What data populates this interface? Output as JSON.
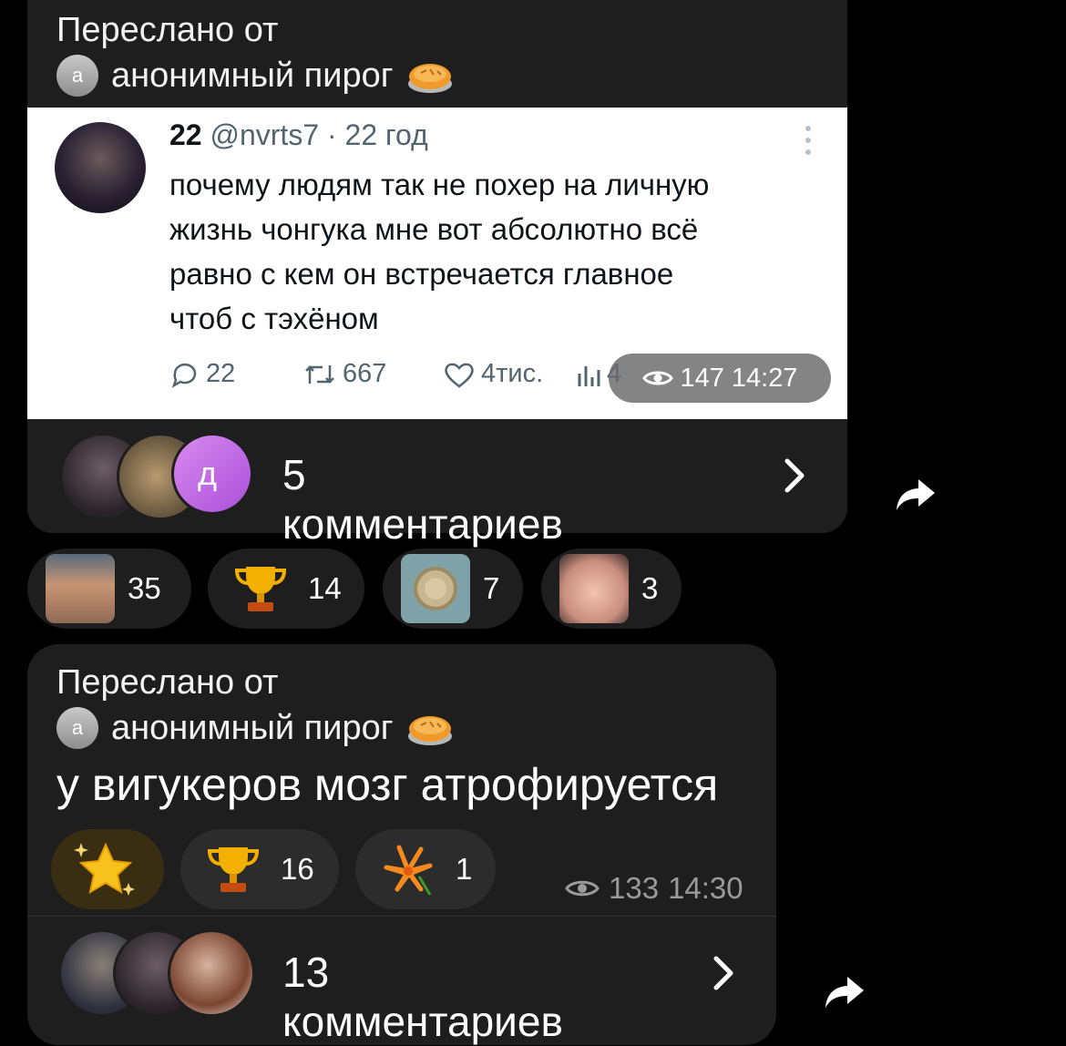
{
  "post1": {
    "forwarded_label": "Переслано от",
    "source_avatar_letter": "а",
    "source_name": "анонимный пирог",
    "tweet": {
      "name": "22",
      "handle": "@nvrts7",
      "dot": "·",
      "time_ago": "22 год",
      "lines": [
        "почему людям так не похер на личную",
        "жизнь чонгука мне вот абсолютно всё",
        "равно с кем он встречается главное",
        "чтоб с тэхёном"
      ],
      "replies": "22",
      "retweets": "667",
      "likes": "4тис.",
      "views": "4"
    },
    "views": "147",
    "time": "14:27",
    "comment_avatar_letter": "д",
    "comments_label": "5 комментариев",
    "reactions": [
      {
        "icon": "photo-reaction-icon",
        "count": "35"
      },
      {
        "icon": "trophy-icon",
        "count": "14"
      },
      {
        "icon": "condom-icon",
        "count": "7"
      },
      {
        "icon": "face-photo-reaction-icon",
        "count": "3"
      }
    ]
  },
  "post2": {
    "forwarded_label": "Переслано от",
    "source_avatar_letter": "а",
    "source_name": "анонимный пирог",
    "text": "у вигукеров мозг атрофируется",
    "reactions": [
      {
        "icon": "sparkle-star-icon",
        "count": ""
      },
      {
        "icon": "trophy-icon",
        "count": "16"
      },
      {
        "icon": "lily-flower-icon",
        "count": "1"
      }
    ],
    "views": "133",
    "time": "14:30",
    "comments_label": "13 комментариев"
  },
  "colors": {
    "background": "#000000",
    "bubble": "#1e1e1e",
    "tweet_bg": "#ffffff",
    "muted": "#9a9a9a",
    "comment_avatar_purple": "#c46ae8"
  }
}
